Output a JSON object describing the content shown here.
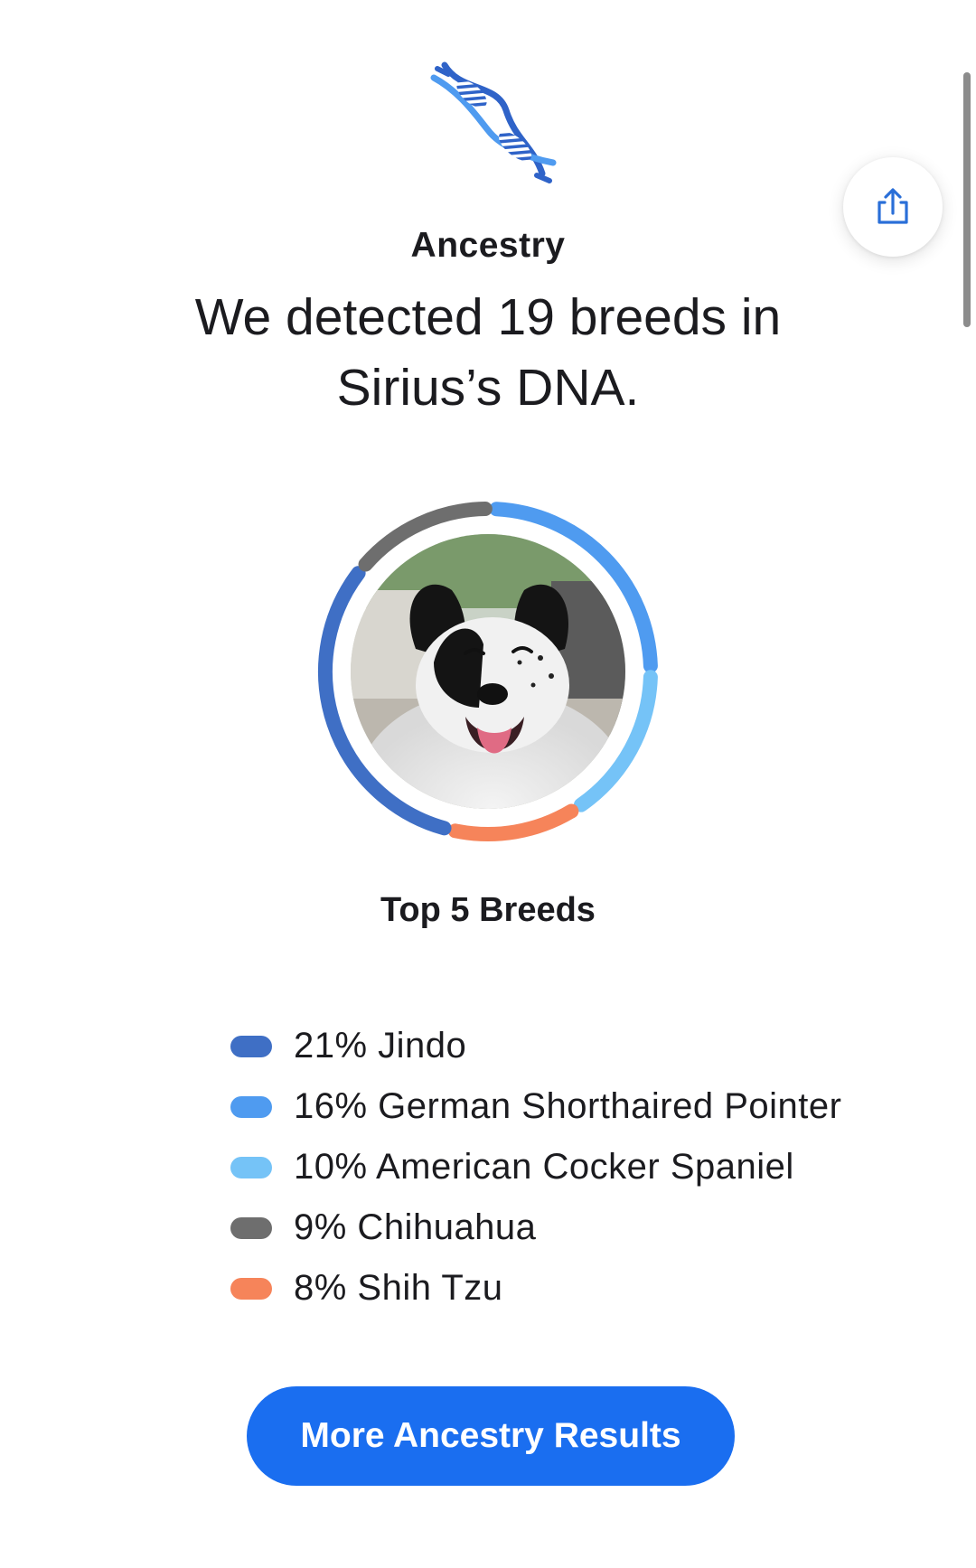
{
  "header": {
    "section_label": "Ancestry",
    "headline": "We detected 19 breeds in Sirius’s DNA.",
    "icons": {
      "top": "dna-icon",
      "share": "share-icon"
    }
  },
  "chart_data": {
    "type": "pie",
    "title": "Top 5 Breeds",
    "segments": [
      {
        "name": "Jindo",
        "value": 21,
        "label": "21% Jindo",
        "color": "#3f6fc5"
      },
      {
        "name": "German Shorthaired Pointer",
        "value": 16,
        "label": "16% German Shorthaired Pointer",
        "color": "#4f9bf0"
      },
      {
        "name": "American Cocker Spaniel",
        "value": 10,
        "label": "10% American Cocker Spaniel",
        "color": "#75c3f7"
      },
      {
        "name": "Chihuahua",
        "value": 9,
        "label": "9% Chihuahua",
        "color": "#6e6e6e"
      },
      {
        "name": "Shih Tzu",
        "value": 8,
        "label": "8% Shih Tzu",
        "color": "#f6845a"
      }
    ]
  },
  "breeds": {
    "title": "Top 5 Breeds"
  },
  "cta": {
    "label": "More Ancestry Results"
  },
  "colors": {
    "accent": "#1a6ef0",
    "text": "#1b1b1f"
  }
}
